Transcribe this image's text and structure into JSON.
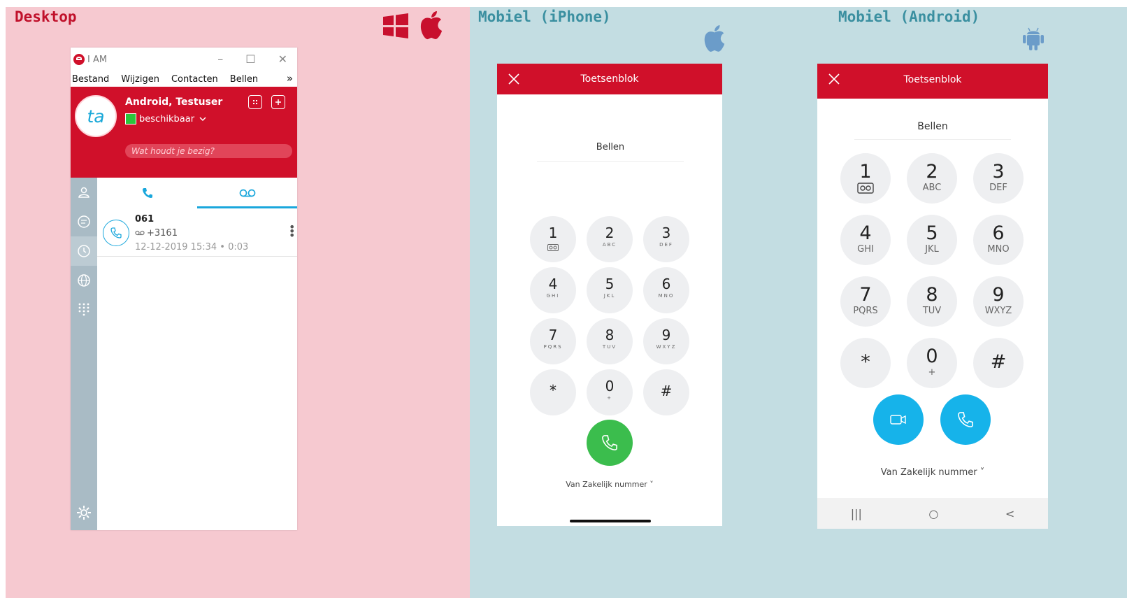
{
  "sections": {
    "desktop": "Desktop",
    "iphone": "Mobiel  (iPhone)",
    "android": "Mobiel (Android)"
  },
  "colors": {
    "brand_red": "#d0102a",
    "desktop_bg": "#f6c9d0",
    "mobile_bg": "#c3dde2",
    "accent_blue": "#1aa7dc",
    "call_green": "#3bbd4d"
  },
  "icons": {
    "windows": "windows-logo-icon",
    "apple": "apple-logo-icon",
    "android": "android-logo-icon"
  },
  "desktop": {
    "window_title": "I AM",
    "window_controls": [
      "–",
      "☐",
      "✕"
    ],
    "menu": [
      "Bestand",
      "Wijzigen",
      "Contacten",
      "Bellen"
    ],
    "menu_more": "»",
    "profile": {
      "initials": "ta",
      "name": "Android, Testuser",
      "status": "beschikbaar",
      "status_placeholder": "Wat houdt je bezig?"
    },
    "sidebar_icons": [
      "contacts-icon",
      "chat-icon",
      "history-icon",
      "globe-icon",
      "dialpad-icon"
    ],
    "active_sidebar": "history-icon",
    "tabs": [
      "phone-icon",
      "voicemail-icon"
    ],
    "active_tab": "voicemail-icon",
    "calls": [
      {
        "number": "061",
        "sub": "+3161",
        "datetime": "12-12-2019 15:34 • 0:03"
      }
    ]
  },
  "iphone": {
    "header_title": "Toetsenblok",
    "input_placeholder": "Bellen",
    "keys": [
      {
        "digit": "1",
        "letters": ""
      },
      {
        "digit": "2",
        "letters": "ABC"
      },
      {
        "digit": "3",
        "letters": "DEF"
      },
      {
        "digit": "4",
        "letters": "GHI"
      },
      {
        "digit": "5",
        "letters": "JKL"
      },
      {
        "digit": "6",
        "letters": "MNO"
      },
      {
        "digit": "7",
        "letters": "PQRS"
      },
      {
        "digit": "8",
        "letters": "TUV"
      },
      {
        "digit": "9",
        "letters": "WXYZ"
      },
      {
        "digit": "*",
        "letters": ""
      },
      {
        "digit": "0",
        "letters": "+"
      },
      {
        "digit": "#",
        "letters": ""
      }
    ],
    "from_label": "Van Zakelijk nummer ˅"
  },
  "android": {
    "header_title": "Toetsenblok",
    "input_placeholder": "Bellen",
    "keys": [
      {
        "digit": "1",
        "letters": ""
      },
      {
        "digit": "2",
        "letters": "ABC"
      },
      {
        "digit": "3",
        "letters": "DEF"
      },
      {
        "digit": "4",
        "letters": "GHI"
      },
      {
        "digit": "5",
        "letters": "JKL"
      },
      {
        "digit": "6",
        "letters": "MNO"
      },
      {
        "digit": "7",
        "letters": "PQRS"
      },
      {
        "digit": "8",
        "letters": "TUV"
      },
      {
        "digit": "9",
        "letters": "WXYZ"
      },
      {
        "digit": "*",
        "letters": ""
      },
      {
        "digit": "0",
        "letters": "+"
      },
      {
        "digit": "#",
        "letters": ""
      }
    ],
    "from_label": "Van Zakelijk nummer ˅",
    "nav": [
      "|||",
      "○",
      "<"
    ]
  }
}
